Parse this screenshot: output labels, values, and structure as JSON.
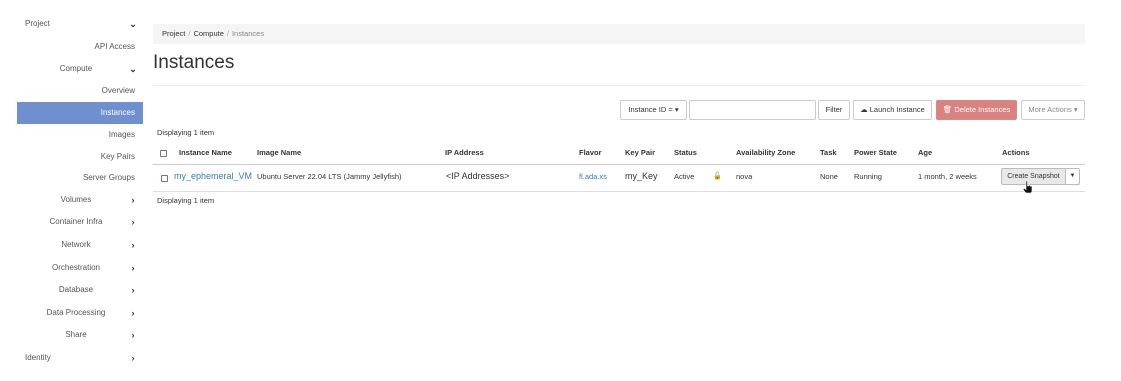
{
  "sidebar": {
    "project": "Project",
    "api_access": "API Access",
    "compute": "Compute",
    "overview": "Overview",
    "instances": "Instances",
    "images": "Images",
    "key_pairs": "Key Pairs",
    "server_groups": "Server Groups",
    "volumes": "Volumes",
    "container_infra": "Container Infra",
    "network": "Network",
    "orchestration": "Orchestration",
    "database": "Database",
    "data_processing": "Data Processing",
    "share": "Share",
    "identity": "Identity",
    "icons": {
      "expanded": "chevron-down-icon",
      "collapsed": "chevron-right-icon"
    }
  },
  "breadcrumb": {
    "project": "Project",
    "compute": "Compute",
    "current": "Instances",
    "separator": "/"
  },
  "page_title": "Instances",
  "toolbar": {
    "filter_field": "Instance ID = ▾",
    "search_value": "",
    "filter_label": "Filter",
    "launch_label": "Launch Instance",
    "delete_label": "Delete Instances",
    "more_label": "More Actions ▾",
    "colors": {
      "danger": "#d9827f",
      "active_nav": "#6f8fcf",
      "link": "#3a7bbf"
    }
  },
  "displaying_top": "Displaying 1 item",
  "displaying_bottom": "Displaying 1 item",
  "table": {
    "columns": {
      "name": "Instance Name",
      "image": "Image Name",
      "ip": "IP Address",
      "flavor": "Flavor",
      "keypair": "Key Pair",
      "status": "Status",
      "zone": "Availability Zone",
      "task": "Task",
      "power": "Power State",
      "age": "Age",
      "actions": "Actions"
    },
    "rows": [
      {
        "name": "my_ephemeral_VM",
        "image": "Ubuntu Server 22.04 LTS (Jammy Jellyfish)",
        "ip": "<IP Addresses>",
        "flavor": "fl.ada.xs",
        "keypair": "my_Key",
        "status": "Active",
        "zone": "nova",
        "task": "None",
        "power": "Running",
        "age": "1 month, 2 weeks",
        "action": "Create Snapshot"
      }
    ]
  }
}
